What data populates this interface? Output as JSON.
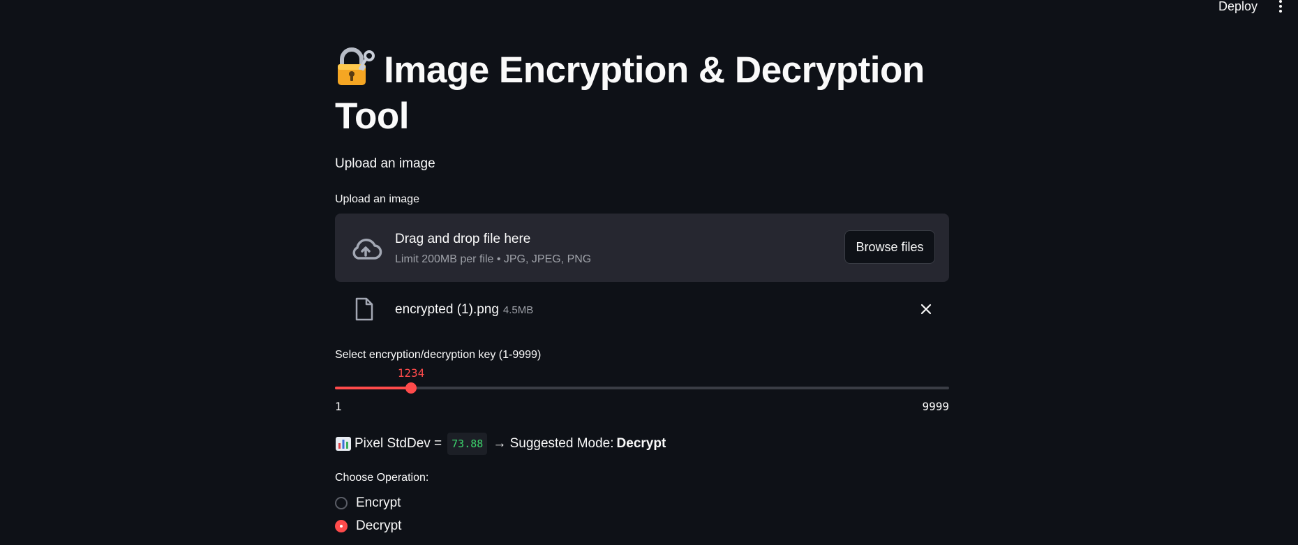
{
  "header": {
    "deploy_label": "Deploy"
  },
  "title": {
    "text": "Image Encryption & Decryption Tool",
    "icon": "lock-with-key-icon"
  },
  "subtitle": "Upload an image",
  "uploader": {
    "label": "Upload an image",
    "drop_text": "Drag and drop file here",
    "limit_text": "Limit 200MB per file • JPG, JPEG, PNG",
    "browse_label": "Browse files"
  },
  "file": {
    "name": "encrypted (1).png",
    "size": "4.5MB"
  },
  "slider": {
    "label": "Select encryption/decryption key (1-9999)",
    "value": 1234,
    "value_text": "1234",
    "min": 1,
    "max": 9999,
    "min_text": "1",
    "max_text": "9999"
  },
  "stats": {
    "prefix": "Pixel StdDev =",
    "value": "73.88",
    "middle": "→ Suggested Mode:",
    "mode": "Decrypt"
  },
  "operation": {
    "label": "Choose Operation:",
    "options": [
      "Encrypt",
      "Decrypt"
    ],
    "selected": "Decrypt"
  },
  "colors": {
    "accent": "#ff4b4b",
    "background": "#0e1117",
    "surface": "#262730",
    "code": "#3dd56d"
  }
}
